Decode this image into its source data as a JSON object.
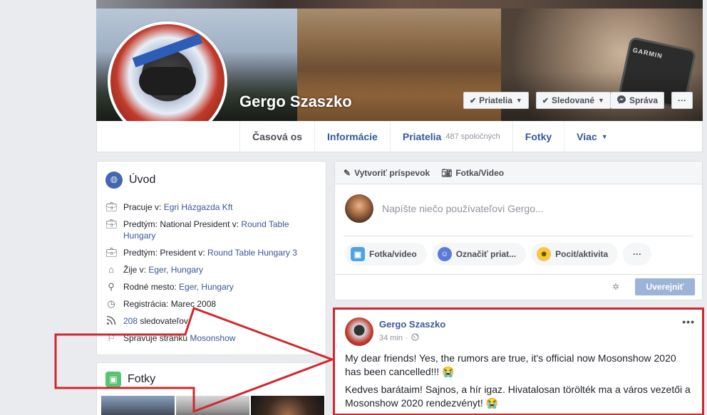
{
  "profile": {
    "name": "Gergo Szaszko",
    "cover_brand": "GARMIN"
  },
  "cover_buttons": {
    "friends": "Priatelia",
    "following": "Sledované",
    "message": "Správa",
    "more": "···"
  },
  "tabs": [
    {
      "label": "Časová os"
    },
    {
      "label": "Informácie"
    },
    {
      "label": "Priatelia",
      "sub": "487 spoločných"
    },
    {
      "label": "Fotky"
    },
    {
      "label": "Viac"
    }
  ],
  "intro": {
    "title": "Úvod",
    "items": [
      {
        "prefix": "Pracuje v: ",
        "link": "Egri Házgazda Kft"
      },
      {
        "prefix": "Predtým: National President v: ",
        "link": "Round Table Hungary"
      },
      {
        "prefix": "Predtým: President v: ",
        "link": "Round Table Hungary 3"
      },
      {
        "prefix": "Žije v: ",
        "link": "Eger, Hungary"
      },
      {
        "prefix": "Rodné mesto: ",
        "link": "Eger, Hungary"
      },
      {
        "prefix": "Registrácia: Marec 2008",
        "link": ""
      },
      {
        "prefix": "",
        "link": "208",
        "suffix": " sledovateľov"
      },
      {
        "prefix": "Spravuje stránku ",
        "link": "Mosonshow"
      }
    ]
  },
  "photos": {
    "title": "Fotky"
  },
  "composer": {
    "create_post": "Vytvoriť príspevok",
    "photo_video_tab": "Fotka/Video",
    "placeholder": "Napíšte niečo používateľovi Gergo...",
    "pill_photo": "Fotka/video",
    "pill_tag": "Označiť priat...",
    "pill_feeling": "Pocit/aktivita",
    "pill_more": "···",
    "publish": "Uverejniť"
  },
  "post": {
    "author": "Gergo Szaszko",
    "time": "34 min",
    "dot": "·",
    "more": "•••",
    "paragraph_1": "My dear friends! Yes, the rumors are true, it's official now Mosonshow 2020 has been cancelled!!! 😭",
    "paragraph_2": "Kedves barátaim! Sajnos, a hír igaz. Hivatalosan törölték ma a város vezetői a Mosonshow 2020 rendezvényt! 😭"
  },
  "colors": {
    "facebook_blue": "#4267b2",
    "link": "#385898",
    "annotation_red": "#d0282e"
  }
}
